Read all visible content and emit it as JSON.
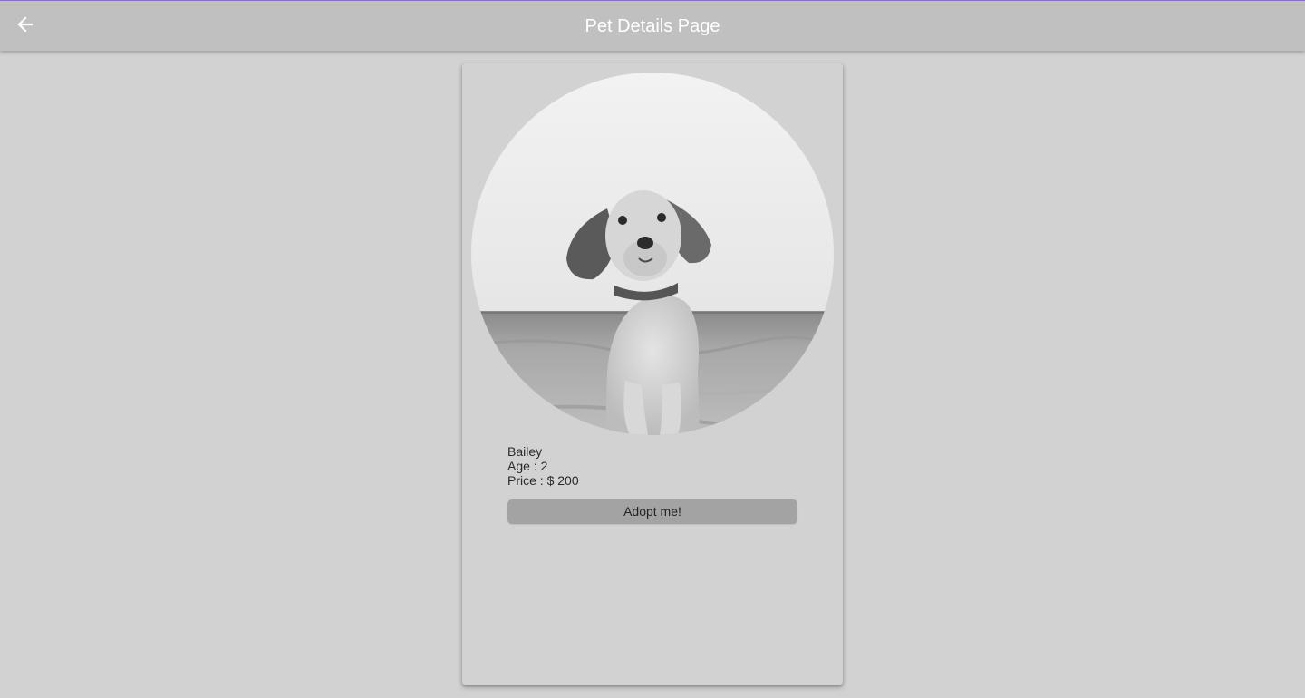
{
  "appbar": {
    "title": "Pet Details Page",
    "back_icon": "arrow-left-icon"
  },
  "pet": {
    "name": "Bailey",
    "age_text": "Age : 2",
    "price_text": "Price : $ 200",
    "photo_description": "dog-photo"
  },
  "actions": {
    "adopt_label": "Adopt me!"
  },
  "colors": {
    "background": "#d2d2d2",
    "appbar": "#c0c0c0",
    "accent_line": "#8e6fc4",
    "button": "#a3a3a3"
  }
}
